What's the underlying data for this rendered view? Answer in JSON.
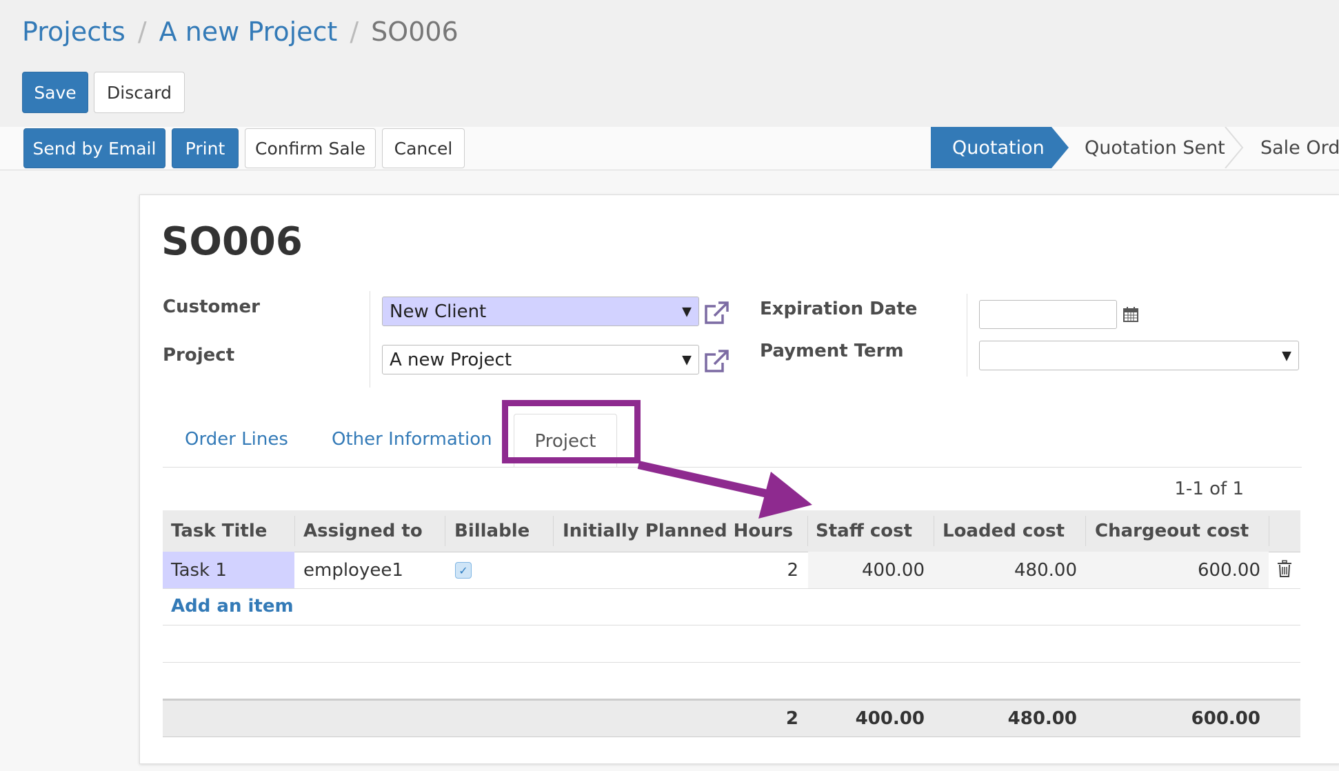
{
  "breadcrumb": {
    "items": [
      "Projects",
      "A new Project"
    ],
    "current": "SO006",
    "separator": "/"
  },
  "actions": {
    "save": "Save",
    "discard": "Discard"
  },
  "statusbar": {
    "buttons": {
      "send_email": "Send by Email",
      "print": "Print",
      "confirm_sale": "Confirm Sale",
      "cancel": "Cancel"
    },
    "stages": [
      "Quotation",
      "Quotation Sent",
      "Sale Orde"
    ],
    "active_stage": "Quotation"
  },
  "form": {
    "title": "SO006",
    "customer_label": "Customer",
    "customer_value": "New Client",
    "project_label": "Project",
    "project_value": "A new Project",
    "expiration_label": "Expiration Date",
    "expiration_value": "",
    "payment_term_label": "Payment Term",
    "payment_term_value": ""
  },
  "tabs": [
    "Order Lines",
    "Other Information",
    "Project"
  ],
  "active_tab": "Project",
  "pager": "1-1 of 1",
  "table": {
    "columns": [
      "Task Title",
      "Assigned to",
      "Billable",
      "Initially Planned Hours",
      "Staff cost",
      "Loaded cost",
      "Chargeout cost"
    ],
    "rows": [
      {
        "task": "Task 1",
        "assigned": "employee1",
        "billable": true,
        "hours": "2",
        "staff": "400.00",
        "loaded": "480.00",
        "chargeout": "600.00"
      }
    ],
    "add_item": "Add an item",
    "totals": {
      "hours": "2",
      "staff": "400.00",
      "loaded": "480.00",
      "chargeout": "600.00"
    }
  },
  "colors": {
    "primary": "#337ab7",
    "required_field": "#d2d2ff",
    "annotation": "#8e2a8f"
  },
  "icons": {
    "external_link": "external-link-icon",
    "calendar": "calendar-icon",
    "trash": "trash-icon",
    "checkbox": "checkbox-checked-icon"
  }
}
